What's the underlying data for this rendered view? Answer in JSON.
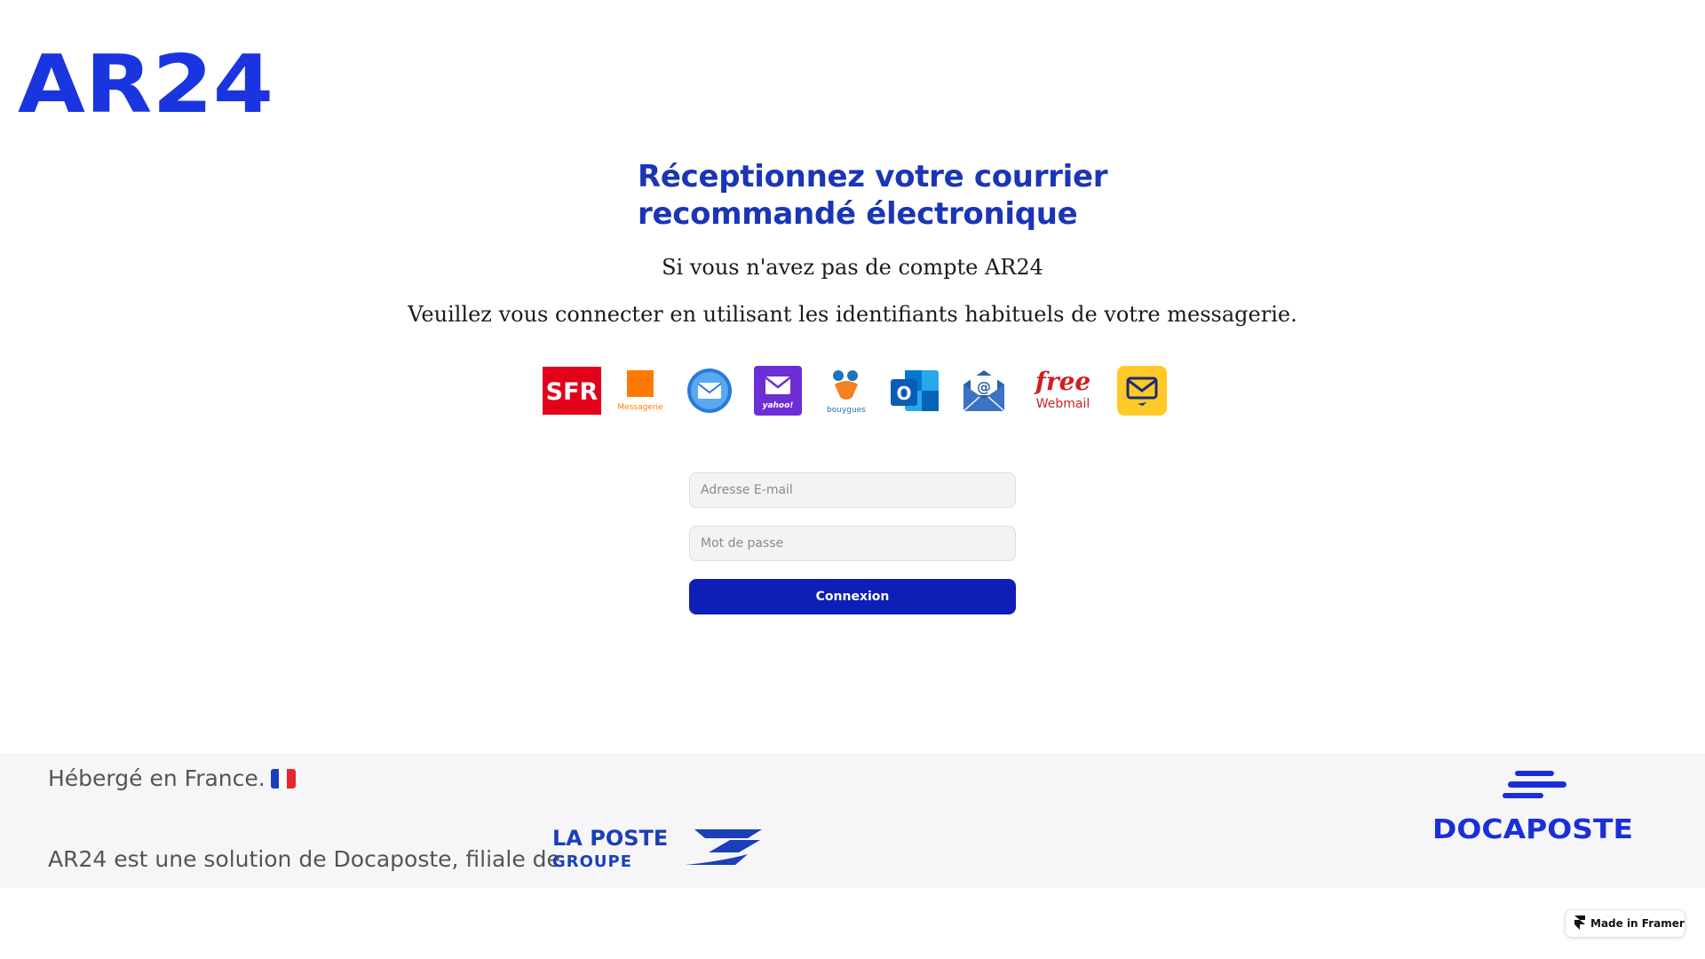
{
  "brand": {
    "logo_text": "AR24",
    "color": "#1a35e0"
  },
  "heading": {
    "line1": "Réceptionnez votre courrier",
    "line2": "recommandé électronique",
    "color": "#1a35b5"
  },
  "subtitles": {
    "line1": "Si vous n'avez pas de compte AR24",
    "line2": "Veuillez vous connecter en utilisant les identifiants habituels de votre messagerie."
  },
  "providers": [
    {
      "name": "sfr",
      "label": "SFR"
    },
    {
      "name": "orange",
      "label": "Messagerie"
    },
    {
      "name": "mail",
      "label": ""
    },
    {
      "name": "yahoo",
      "label": "yahoo!"
    },
    {
      "name": "bouygues",
      "label": "bouygues"
    },
    {
      "name": "outlook",
      "label": "O"
    },
    {
      "name": "email-at",
      "label": "@"
    },
    {
      "name": "free",
      "label_top": "free",
      "label_bottom": "Webmail"
    },
    {
      "name": "laposte-mail",
      "label": ""
    }
  ],
  "form": {
    "email_placeholder": "Adresse E-mail",
    "password_placeholder": "Mot de passe",
    "submit_label": "Connexion",
    "accent": "#0e1fb8"
  },
  "footer": {
    "hosted": "Hébergé en France.",
    "solution": "AR24 est une solution de Docaposte, filiale de",
    "laposte_line1": "LA POSTE",
    "laposte_line2": "GROUPE",
    "docaposte": "DOCAPOSTE"
  },
  "badge": {
    "label": "Made in Framer"
  }
}
